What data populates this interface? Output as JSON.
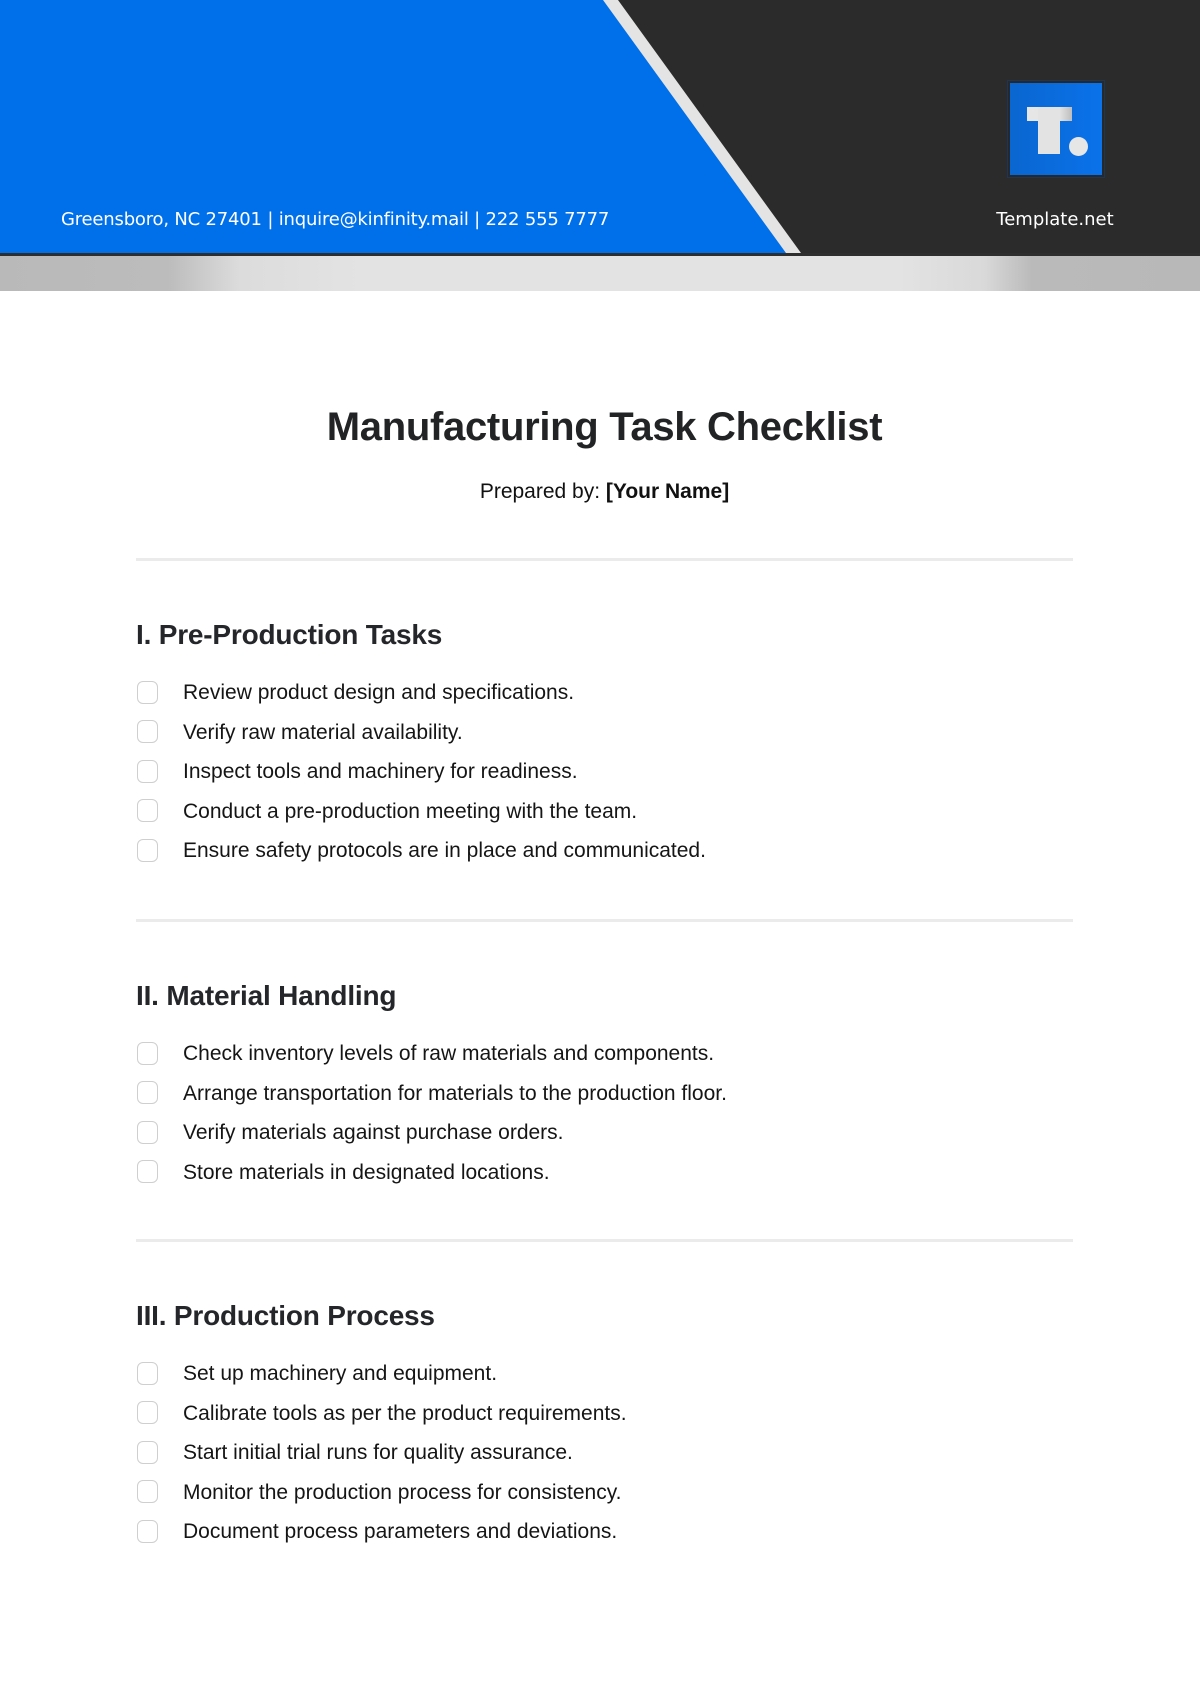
{
  "header": {
    "contact": "Greensboro, NC 27401 | inquire@kinfinity.mail | 222 555 7777",
    "brand": "Template.net",
    "logo_icon": "template-net-logo",
    "colors": {
      "blue": "#006fea",
      "dark": "#2b2b2b",
      "stripe": "#e4e4e4",
      "band_light": "#e3e3e3",
      "band_dark": "#b9b9b9"
    }
  },
  "document": {
    "title": "Manufacturing Task Checklist",
    "prepared_label": "Prepared by: ",
    "prepared_value": "[Your Name]"
  },
  "sections": [
    {
      "heading": "I. Pre-Production Tasks",
      "items": [
        {
          "text": "Review product design and specifications.",
          "checked": false
        },
        {
          "text": "Verify raw material availability.",
          "checked": false
        },
        {
          "text": "Inspect tools and machinery for readiness.",
          "checked": false
        },
        {
          "text": "Conduct a pre-production meeting with the team.",
          "checked": false
        },
        {
          "text": "Ensure safety protocols are in place and communicated.",
          "checked": false
        }
      ]
    },
    {
      "heading": "II. Material Handling",
      "items": [
        {
          "text": "Check inventory levels of raw materials and components.",
          "checked": false
        },
        {
          "text": "Arrange transportation for materials to the production floor.",
          "checked": false
        },
        {
          "text": "Verify materials against purchase orders.",
          "checked": false
        },
        {
          "text": "Store materials in designated locations.",
          "checked": false
        }
      ]
    },
    {
      "heading": "III. Production Process",
      "items": [
        {
          "text": "Set up machinery and equipment.",
          "checked": false
        },
        {
          "text": "Calibrate tools as per the product requirements.",
          "checked": false
        },
        {
          "text": "Start initial trial runs for quality assurance.",
          "checked": false
        },
        {
          "text": "Monitor the production process for consistency.",
          "checked": false
        },
        {
          "text": "Document process parameters and deviations.",
          "checked": false
        }
      ]
    }
  ]
}
